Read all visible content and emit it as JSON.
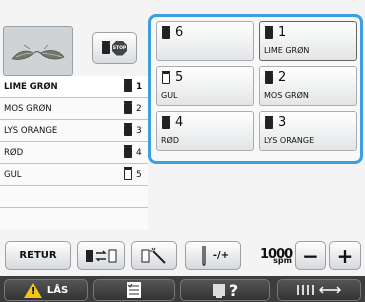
{
  "stop_button": {
    "label": "STOP"
  },
  "thread_list": [
    {
      "name": "LIME GRØN",
      "number": "1",
      "filled": true,
      "selected": true
    },
    {
      "name": "MOS GRØN",
      "number": "2",
      "filled": true,
      "selected": false
    },
    {
      "name": "LYS ORANGE",
      "number": "3",
      "filled": true,
      "selected": false
    },
    {
      "name": "RØD",
      "number": "4",
      "filled": true,
      "selected": false
    },
    {
      "name": "GUL",
      "number": "5",
      "filled": false,
      "selected": false
    }
  ],
  "thread_tiles": [
    {
      "number": "6",
      "name": "",
      "filled": true
    },
    {
      "number": "1",
      "name": "LIME GRØN",
      "filled": true
    },
    {
      "number": "5",
      "name": "GUL",
      "filled": false
    },
    {
      "number": "2",
      "name": "MOS GRØN",
      "filled": true
    },
    {
      "number": "4",
      "name": "RØD",
      "filled": true
    },
    {
      "number": "3",
      "name": "LYS ORANGE",
      "filled": true
    }
  ],
  "controls": {
    "retur_label": "RETUR",
    "speed_value": "1000",
    "speed_unit": "spm",
    "minus_label": "−",
    "plus_label": "+",
    "needle_label": "-/+"
  },
  "bottom": {
    "lock_label": "LÅS",
    "help_label": "?"
  },
  "colors": {
    "panel_border": "#3b9fe0",
    "bottom_bar": "#3d3d3d",
    "warning": "#f3c41a"
  }
}
